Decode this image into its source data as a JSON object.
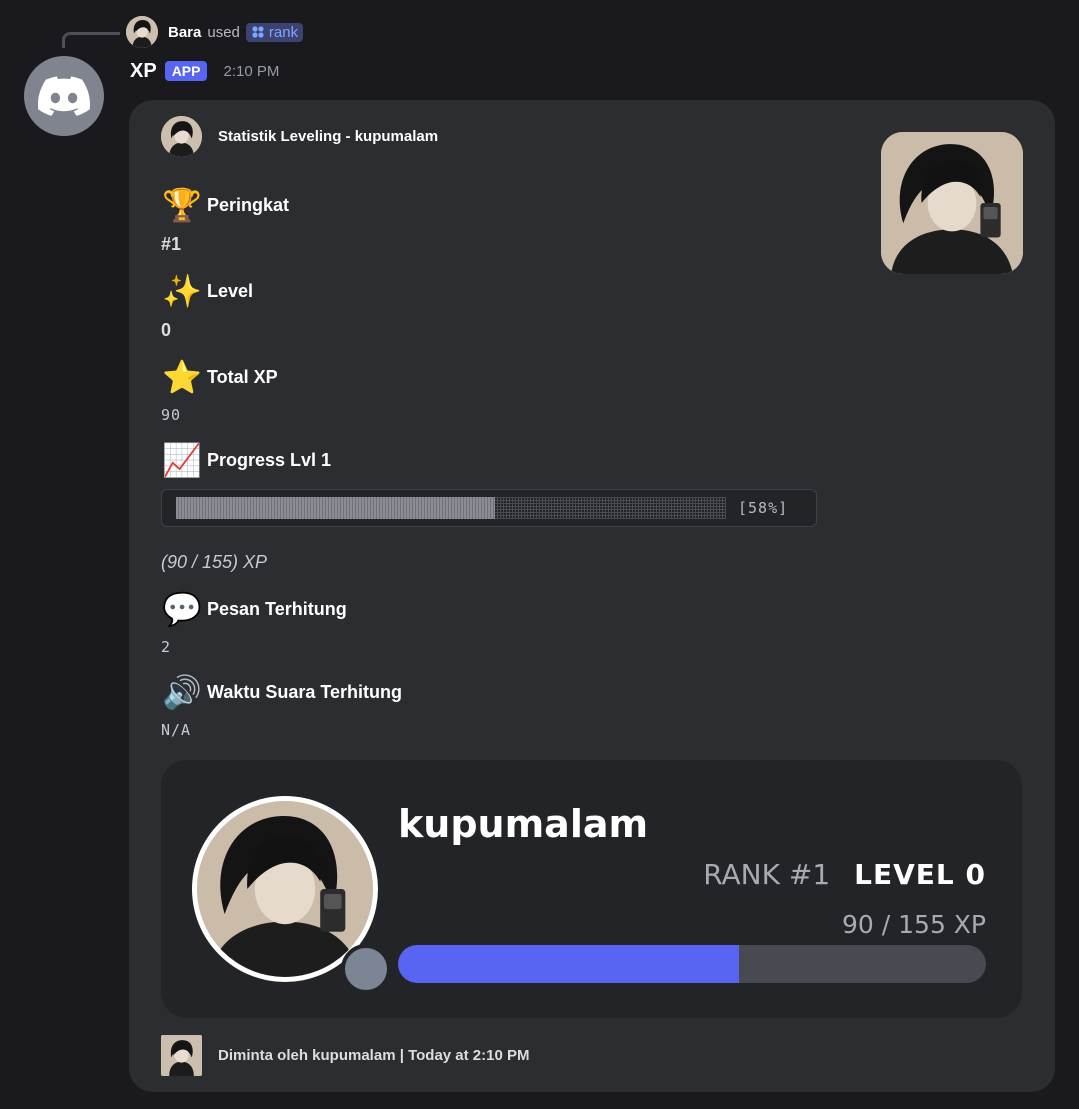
{
  "reply": {
    "user_name": "Bara",
    "used_text": "used",
    "command_name": "rank"
  },
  "message": {
    "bot_name": "XP",
    "badge": "APP",
    "time": "2:10 PM"
  },
  "embed": {
    "author": "Statistik Leveling - kupumalam",
    "fields": {
      "rank": {
        "emoji": "🏆",
        "label": "Peringkat",
        "value": "#1"
      },
      "level": {
        "emoji": "✨",
        "label": "Level",
        "value": "0"
      },
      "total_xp": {
        "emoji": "⭐",
        "label": "Total XP",
        "value": "90"
      },
      "progress": {
        "emoji": "📈",
        "label": "Progress Lvl 1",
        "percent_label": "[58%]",
        "fraction": 0.58,
        "xp_text": "(90 / 155) XP"
      },
      "messages": {
        "emoji": "💬",
        "label": "Pesan Terhitung",
        "value": "2"
      },
      "voice": {
        "emoji": "🔊",
        "label": "Waktu Suara Terhitung",
        "value": "N/A"
      }
    },
    "rank_card": {
      "username": "kupumalam",
      "rank": "RANK #1",
      "level": "LEVEL 0",
      "xp": "90 / 155 XP",
      "progress_fraction": 0.58,
      "accent_color": "#5865f2"
    },
    "footer": "Diminta oleh kupumalam | Today at 2:10 PM"
  }
}
